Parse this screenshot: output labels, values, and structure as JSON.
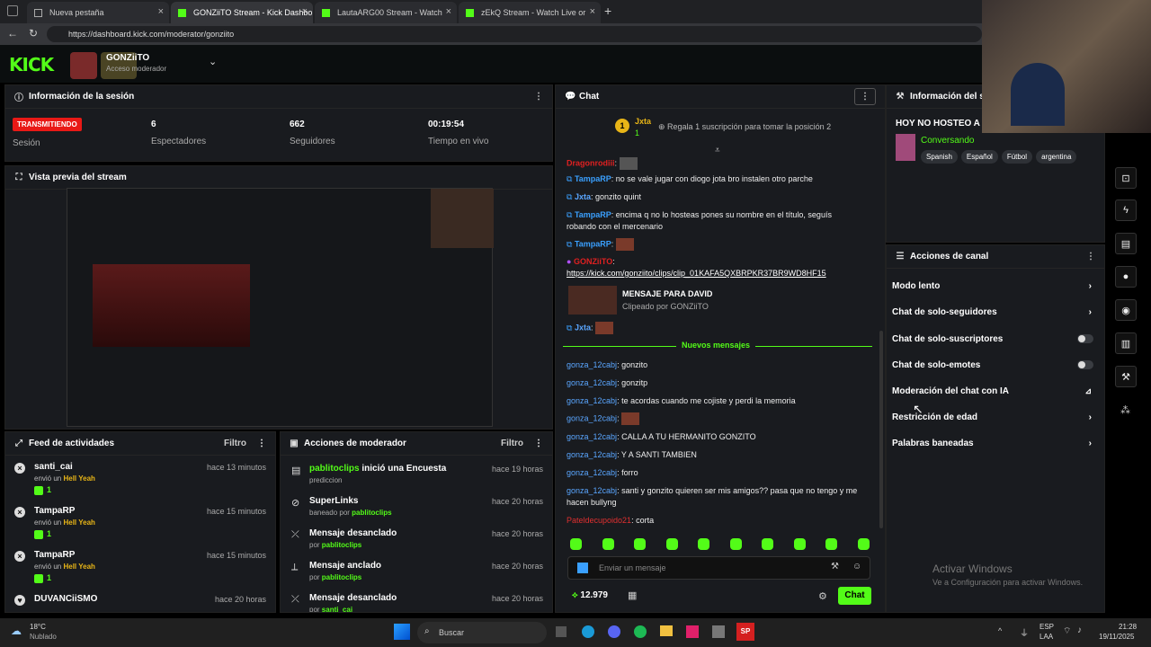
{
  "tabs": [
    {
      "label": "Nueva pestaña"
    },
    {
      "label": "GONZiiTO Stream - Kick Dashbo"
    },
    {
      "label": "LautaARG00 Stream - Watch"
    },
    {
      "label": "zEkQ Stream - Watch Live or"
    }
  ],
  "url": "https://dashboard.kick.com/moderator/gonziito",
  "header": {
    "logo": "KICK",
    "channel": "GONZiiTO",
    "role": "Acceso moderador"
  },
  "session": {
    "title": "Información de la sesión",
    "status": "TRANSMITIENDO",
    "status_label": "Sesión",
    "viewers": "6",
    "viewers_label": "Espectadores",
    "followers": "662",
    "followers_label": "Seguidores",
    "time": "00:19:54",
    "time_label": "Tiempo en vivo"
  },
  "preview": {
    "title": "Vista previa del stream"
  },
  "feed": {
    "title": "Feed de actividades",
    "filter": "Filtro",
    "items": [
      {
        "user": "santi_cai",
        "text": "envió un",
        "item": "Hell Yeah",
        "count": "1",
        "time": "hace 13 minutos"
      },
      {
        "user": "TampaRP",
        "text": "envió un",
        "item": "Hell Yeah",
        "count": "1",
        "time": "hace 15 minutos"
      },
      {
        "user": "TampaRP",
        "text": "envió un",
        "item": "Hell Yeah",
        "count": "1",
        "time": "hace 15 minutos"
      },
      {
        "user": "DUVANCiiSMO",
        "text": "",
        "item": "",
        "count": "",
        "time": "hace 20 horas"
      }
    ]
  },
  "modactions": {
    "title": "Acciones de moderador",
    "filter": "Filtro",
    "items": [
      {
        "title": "pablitoclips",
        "title2": " inició una Encuesta",
        "sub": "prediccion",
        "sub_user": "",
        "time": "hace 19 horas"
      },
      {
        "title": "SuperLinks",
        "title2": "",
        "sub": "baneado por ",
        "sub_user": "pablitoclips",
        "time": "hace 20 horas"
      },
      {
        "title": "Mensaje desanclado",
        "title2": "",
        "sub": "por ",
        "sub_user": "pablitoclips",
        "time": "hace 20 horas"
      },
      {
        "title": "Mensaje anclado",
        "title2": "",
        "sub": "por ",
        "sub_user": "pablitoclips",
        "time": "hace 20 horas"
      },
      {
        "title": "Mensaje desanclado",
        "title2": "",
        "sub": "por ",
        "sub_user": "santi_cai",
        "time": "hace 20 horas"
      }
    ]
  },
  "chat": {
    "title": "Chat",
    "gift_user": "Jxta",
    "gift_count": "1",
    "gift_text": "Regala 1 suscripción para tomar la posición 2",
    "messages": [
      {
        "user": "Dragonrodiii",
        "text": ""
      },
      {
        "user": "TampaRP",
        "text": "no se vale jugar con diogo jota bro instalen otro parche"
      },
      {
        "user": "Jxta",
        "text": "gonzito quint"
      },
      {
        "user": "TampaRP",
        "text": "encima q no lo hosteas pones su nombre en el título, seguís robando con el mercenario"
      },
      {
        "user": "TampaRP",
        "text": ""
      },
      {
        "user": "GONZiiTO",
        "text": "https://kick.com/gonziito/clips/clip_01KAFA5QXBRPKR37BR9WD8HF15"
      }
    ],
    "clip_title": "MENSAJE PARA DAVID",
    "clip_sub": "Clipeado por GONZiiTO",
    "jxta2": "Jxta",
    "new_messages": "Nuevos mensajes",
    "messages2": [
      {
        "user": "gonza_12cabj",
        "text": "gonzito"
      },
      {
        "user": "gonza_12cabj",
        "text": "gonzitp"
      },
      {
        "user": "gonza_12cabj",
        "text": "te acordas cuando me cojiste y perdi la memoria"
      },
      {
        "user": "gonza_12cabj",
        "text": ""
      },
      {
        "user": "gonza_12cabj",
        "text": "CALLA A TU HERMANITO GONZITO"
      },
      {
        "user": "gonza_12cabj",
        "text": "Y A SANTI TAMBIEN"
      },
      {
        "user": "gonza_12cabj",
        "text": "forro"
      },
      {
        "user": "gonza_12cabj",
        "text": "santi y gonzito quieren ser mis amigos?? pasa que no tengo y me hacen bullyng"
      },
      {
        "user": "Pateldecupoido21",
        "text": "corta"
      }
    ],
    "placeholder": "Enviar un mensaje",
    "points": "12.979",
    "send": "Chat"
  },
  "streaminfo": {
    "title": "Información del stream",
    "stream_title": "HOY NO HOSTEO A M",
    "category": "Conversando",
    "tags": [
      "Spanish",
      "Español",
      "Fútbol",
      "argentina"
    ]
  },
  "channel_actions": {
    "title": "Acciones de canal",
    "items": [
      {
        "label": "Modo lento",
        "type": "chevron"
      },
      {
        "label": "Chat de solo-seguidores",
        "type": "chevron"
      },
      {
        "label": "Chat de solo-suscriptores",
        "type": "toggle"
      },
      {
        "label": "Chat de solo-emotes",
        "type": "toggle"
      },
      {
        "label": "Moderación del chat con IA",
        "type": "chart"
      },
      {
        "label": "Restricción de edad",
        "type": "chevron"
      },
      {
        "label": "Palabras baneadas",
        "type": "chevron"
      }
    ]
  },
  "watermark": {
    "line1": "Activar Windows",
    "line2": "Ve a Configuración para activar Windows."
  },
  "taskbar": {
    "weather_temp": "18°C",
    "weather_desc": "Nublado",
    "search": "Buscar",
    "lang1": "ESP",
    "lang2": "LAA",
    "time": "21:28",
    "date": "19/11/2025"
  },
  "colors": {
    "accent": "#53fc18",
    "panel": "#191b1f",
    "live": "#e91916"
  }
}
